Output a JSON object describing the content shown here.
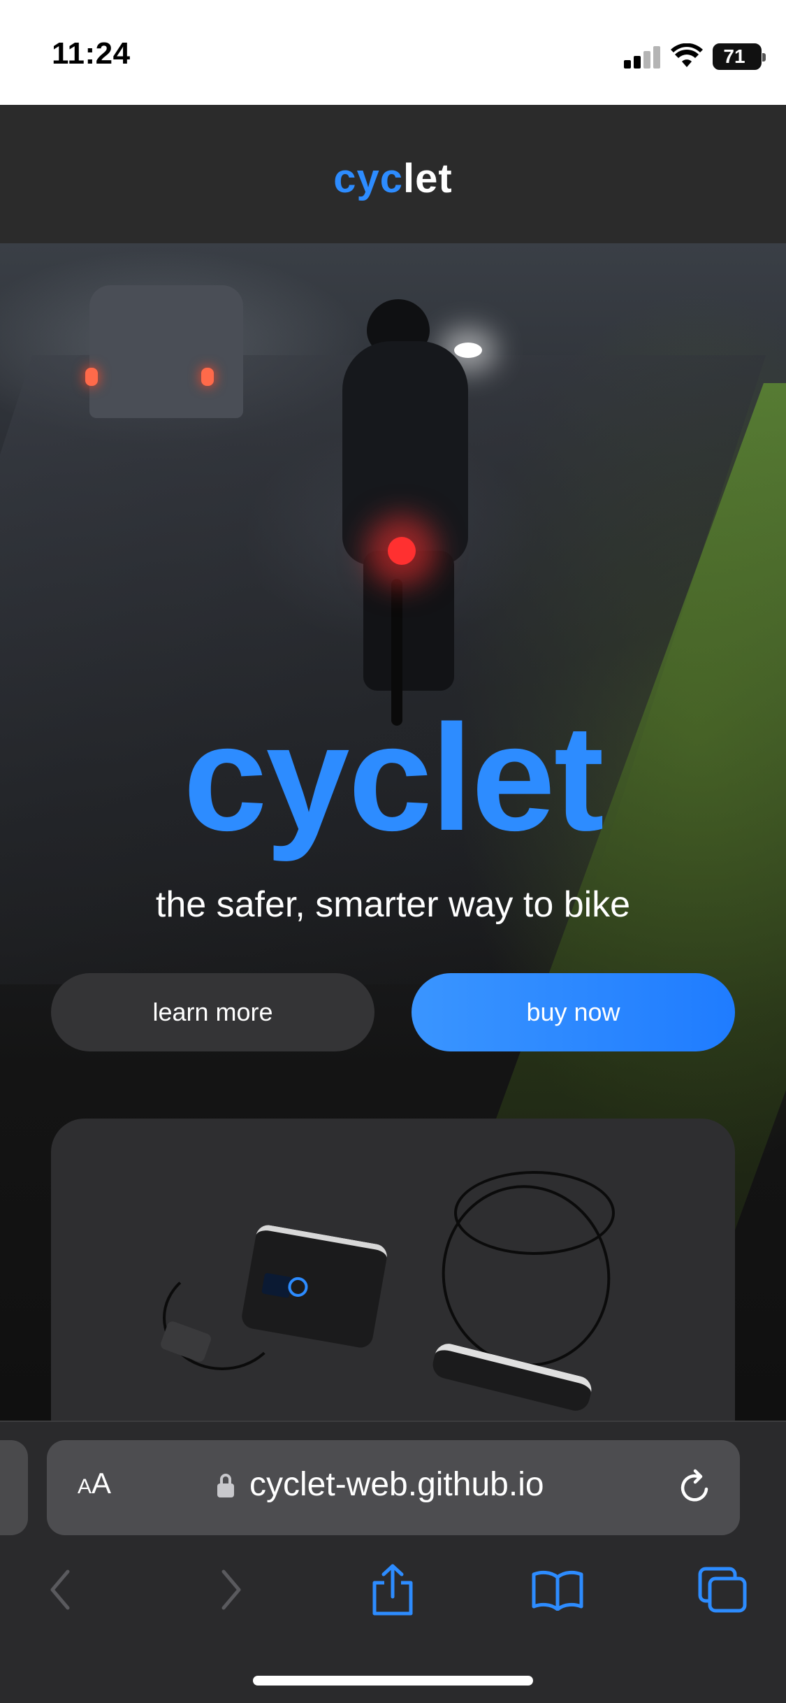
{
  "status_bar": {
    "time": "11:24",
    "battery": "71"
  },
  "header": {
    "logo_part1": "cyc",
    "logo_part2": "let"
  },
  "hero": {
    "title": "cyclet",
    "tagline": "the safer, smarter way to bike",
    "learn_more_label": "learn more",
    "buy_now_label": "buy now"
  },
  "browser": {
    "aa_small": "A",
    "aa_large": "A",
    "url": "cyclet-web.github.io"
  },
  "colors": {
    "brand_blue": "#2d8cff",
    "status_bar_bg": "#ffffff",
    "header_bg": "#2b2b2b",
    "browser_bg": "#2a2a2c",
    "toolbar_icon": "#2d8cff",
    "toolbar_icon_disabled": "#5a5a5e"
  },
  "icons": {
    "signal": "cellular-signal-icon",
    "wifi": "wifi-icon",
    "battery": "battery-icon",
    "lock": "lock-icon",
    "reload": "reload-icon",
    "back": "chevron-left-icon",
    "forward": "chevron-right-icon",
    "share": "share-icon",
    "bookmarks": "book-icon",
    "tabs": "tabs-icon"
  }
}
